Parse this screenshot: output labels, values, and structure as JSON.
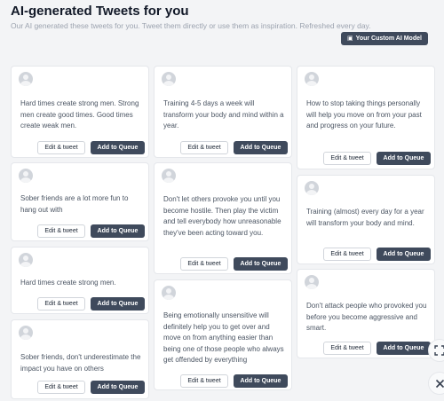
{
  "header": {
    "title": "AI-generated Tweets for you",
    "subtitle": "Our AI generated these tweets for you. Tweet them directly or use them as inspiration. Refreshed every day.",
    "custom_model_label": "Your Custom AI Model"
  },
  "actions": {
    "edit_label": "Edit & tweet",
    "queue_label": "Add to Queue"
  },
  "tweets": {
    "c1": [
      "Hard times create strong men. Strong men create good times. Good times create weak men.",
      "Sober friends are a lot more fun to hang out with",
      "Hard times create strong men.",
      "Sober friends, don't underestimate the impact you have on others"
    ],
    "c2": [
      "Training 4-5 days a week will transform your body and mind within a year.",
      "Don't let others provoke you until you become hostile. Then play the victim and tell everybody how unreasonable they've been acting toward you.",
      "Being emotionally unsensitive will definitely help you to get over and move on from anything easier than being one of those people who always get offended by everything"
    ],
    "c3": [
      "How to stop taking things personally will help you move on from your past and progress on your future.",
      "Training (almost) every day for a year will transform your body and mind.",
      "Don't attack people who provoked you before you become aggressive and smart."
    ]
  },
  "icons": {
    "avatar": "user-avatar-icon",
    "model": "robot-icon",
    "expand": "expand-icon",
    "close": "close-icon"
  }
}
